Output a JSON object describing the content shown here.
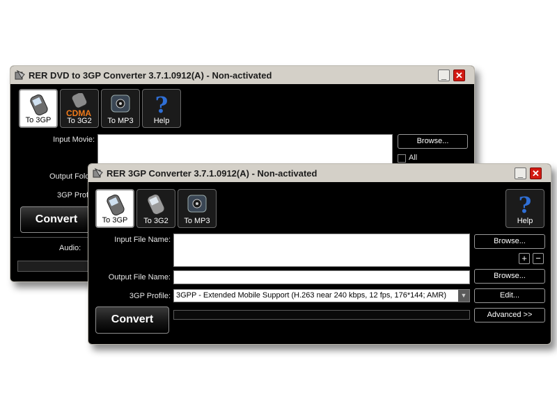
{
  "back_window": {
    "title": "RER DVD to 3GP Converter 3.7.1.0912(A) - Non-activated",
    "toolbar": [
      {
        "label": "To 3GP",
        "icon": "phone-icon",
        "active": true
      },
      {
        "label": "To 3G2",
        "icon": "cdma-phone-icon",
        "badge": "CDMA",
        "active": false
      },
      {
        "label": "To MP3",
        "icon": "mp3-player-icon",
        "active": false
      },
      {
        "label": "Help",
        "icon": "help-icon",
        "active": false
      }
    ],
    "input_movie_label": "Input Movie:",
    "output_folder_label": "Output Fold",
    "profile_label": "3GP Profi",
    "browse_label": "Browse...",
    "all_label": "All",
    "convert_label": "Convert",
    "audio_label": "Audio:"
  },
  "front_window": {
    "title": "RER 3GP Converter 3.7.1.0912(A) - Non-activated",
    "toolbar": [
      {
        "label": "To 3GP",
        "icon": "phone-icon",
        "active": true
      },
      {
        "label": "To 3G2",
        "icon": "phone-icon",
        "active": false
      },
      {
        "label": "To MP3",
        "icon": "mp3-player-icon",
        "active": false
      }
    ],
    "help_label": "Help",
    "input_file_label": "Input File Name:",
    "input_file_value": "",
    "output_file_label": "Output File Name:",
    "output_file_value": "",
    "profile_label": "3GP Profile:",
    "profile_value": "3GPP - Extended Mobile Support (H.263 near 240 kbps, 12 fps, 176*144; AMR)",
    "browse_input_label": "Browse...",
    "browse_output_label": "Browse...",
    "add_symbol": "+",
    "remove_symbol": "−",
    "edit_label": "Edit...",
    "advanced_label": "Advanced >>",
    "convert_label": "Convert",
    "progress": 0
  },
  "colors": {
    "title_bg": "#d4d0c8",
    "body_bg": "#000000",
    "close_red": "#d21a12"
  }
}
